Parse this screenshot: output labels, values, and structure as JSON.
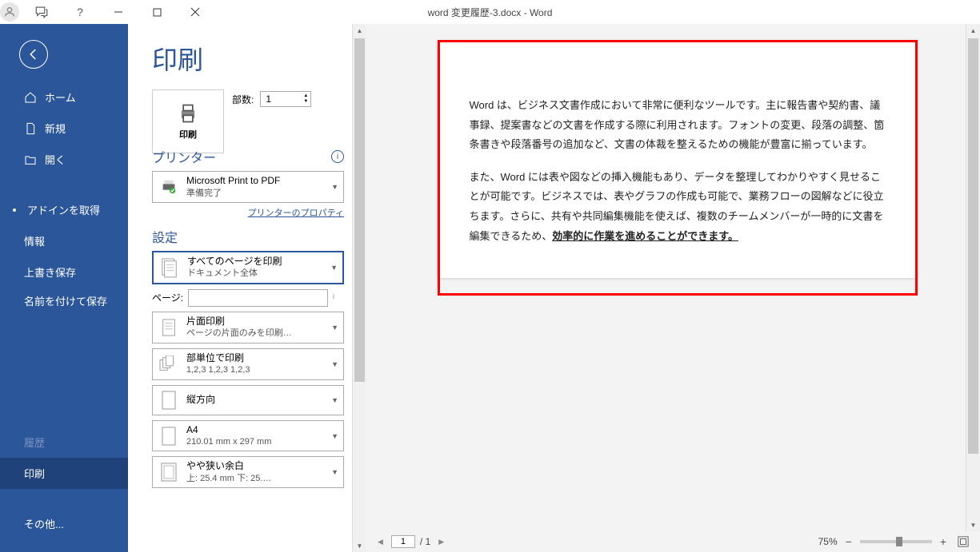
{
  "titlebar": {
    "title": "word 変更履歴-3.docx  -  Word",
    "help": "?"
  },
  "sidebar": {
    "home": "ホーム",
    "new": "新規",
    "open": "開く",
    "getaddins": "アドインを取得",
    "info": "情報",
    "save": "上書き保存",
    "saveas": "名前を付けて保存",
    "history": "履歴",
    "print": "印刷",
    "other": "その他..."
  },
  "panel": {
    "title": "印刷",
    "print_label": "印刷",
    "copies_label": "部数:",
    "copies_value": "1",
    "printer_head": "プリンター",
    "printer_name": "Microsoft Print to PDF",
    "printer_status": "準備完了",
    "printer_props": "プリンターのプロパティ",
    "settings_head": "設定",
    "all_pages_title": "すべてのページを印刷",
    "all_pages_sub": "ドキュメント全体",
    "pages_label": "ページ:",
    "pages_value": "",
    "oneside_title": "片面印刷",
    "oneside_sub": "ページの片面のみを印刷…",
    "collate_title": "部単位で印刷",
    "collate_sub": "1,2,3    1,2,3    1,2,3",
    "orientation_title": "縦方向",
    "paper_title": "A4",
    "paper_sub": "210.01 mm x 297 mm",
    "margin_title": "やや狭い余白",
    "margin_sub": "上: 25.4 mm 下: 25.…"
  },
  "preview": {
    "para1": "Word は、ビジネス文書作成において非常に便利なツールです。主に報告書や契約書、議事録、提案書などの文書を作成する際に利用されます。フォントの変更、段落の調整、箇条書きや段落番号の追加など、文書の体裁を整えるための機能が豊富に揃っています。",
    "para2_a": "また、Word には表や図などの挿入機能もあり、データを整理してわかりやすく見せることが可能です。ビジネスでは、表やグラフの作成も可能で、業務フローの図解などに役立ちます。さらに、共有や共同編集機能を使えば、複数のチームメンバーが一時的に文書を編集できるため、",
    "para2_b": "効率的に作業を進めることができます。"
  },
  "footer": {
    "page_current": "1",
    "page_total": "/ 1",
    "zoom": "75%"
  }
}
